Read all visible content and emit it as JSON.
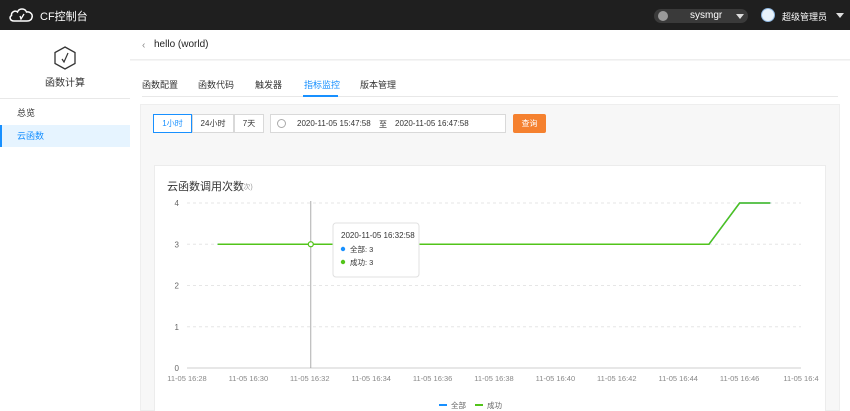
{
  "topbar": {
    "brand": "CF控制台",
    "user_select": "sysmgr",
    "admin_name": "超级管理员"
  },
  "sidebar": {
    "title": "函数计算",
    "items": [
      {
        "label": "总览"
      },
      {
        "label": "云函数"
      }
    ]
  },
  "page": {
    "title": "hello (world)"
  },
  "tabs": [
    {
      "label": "函数配置"
    },
    {
      "label": "函数代码"
    },
    {
      "label": "触发器"
    },
    {
      "label": "指标监控"
    },
    {
      "label": "版本管理"
    }
  ],
  "filters": {
    "ranges": [
      "1小时",
      "24小时",
      "7天"
    ],
    "active_range": "1小时",
    "start": "2020-11-05 15:47:58",
    "separator": "至",
    "end": "2020-11-05 16:47:58",
    "query_label": "查询"
  },
  "colors": {
    "accent": "#1890ff",
    "query": "#f5812f",
    "success": "#52c41a",
    "total": "#1890ff"
  },
  "chart_data": {
    "type": "line",
    "title": "云函数调用次数",
    "unit": "(次)",
    "x_ticks": [
      "11-05 16:28",
      "11-05 16:30",
      "11-05 16:32",
      "11-05 16:34",
      "11-05 16:36",
      "11-05 16:38",
      "11-05 16:40",
      "11-05 16:42",
      "11-05 16:44",
      "11-05 16:46",
      "11-05 16:4"
    ],
    "y_ticks": [
      0,
      1,
      2,
      3,
      4
    ],
    "ylim": [
      0,
      4
    ],
    "series": [
      {
        "name": "全部",
        "points": [
          [
            "16:29",
            3
          ],
          [
            "16:45",
            3
          ],
          [
            "16:46",
            4
          ],
          [
            "16:47",
            4
          ]
        ]
      },
      {
        "name": "成功",
        "points": [
          [
            "16:29",
            3
          ],
          [
            "16:45",
            3
          ],
          [
            "16:46",
            4
          ],
          [
            "16:47",
            4
          ]
        ]
      }
    ],
    "tooltip": {
      "time": "2020-11-05 16:32:58",
      "rows": [
        {
          "label": "全部: 3"
        },
        {
          "label": "成功: 3"
        }
      ]
    },
    "legend": [
      "全部",
      "成功"
    ],
    "legend_position": "bottom-center"
  }
}
